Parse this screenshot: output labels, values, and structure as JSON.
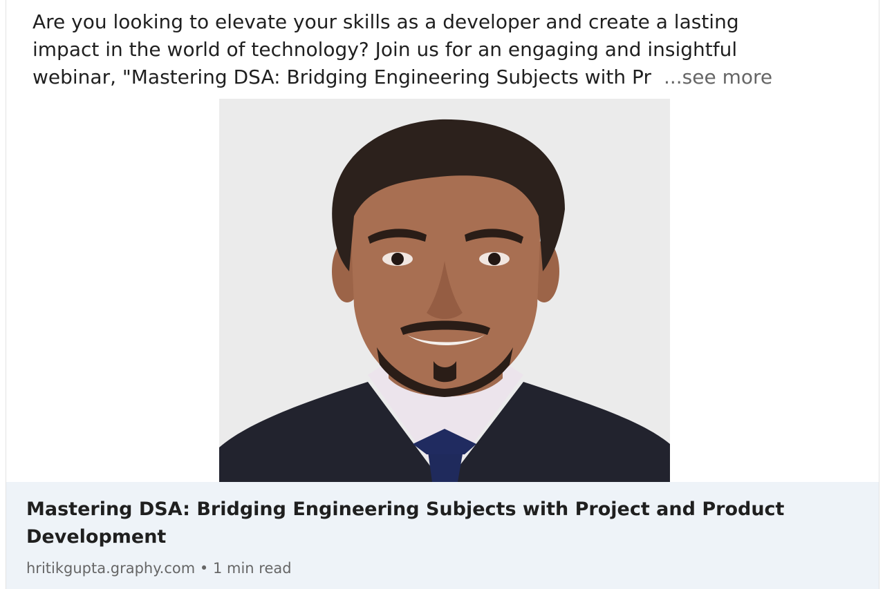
{
  "post": {
    "text_lines": [
      "Are you looking to elevate your skills as a developer and create a lasting",
      "impact in the world of technology? Join us for an engaging and insightful",
      "webinar, \"Mastering DSA: Bridging Engineering Subjects with Pr"
    ],
    "see_more": "...see more"
  },
  "link_preview": {
    "title": "Mastering DSA: Bridging Engineering Subjects with Project and Product Development",
    "domain": "hritikgupta.graphy.com",
    "separator": "•",
    "read_time": "1 min read"
  }
}
